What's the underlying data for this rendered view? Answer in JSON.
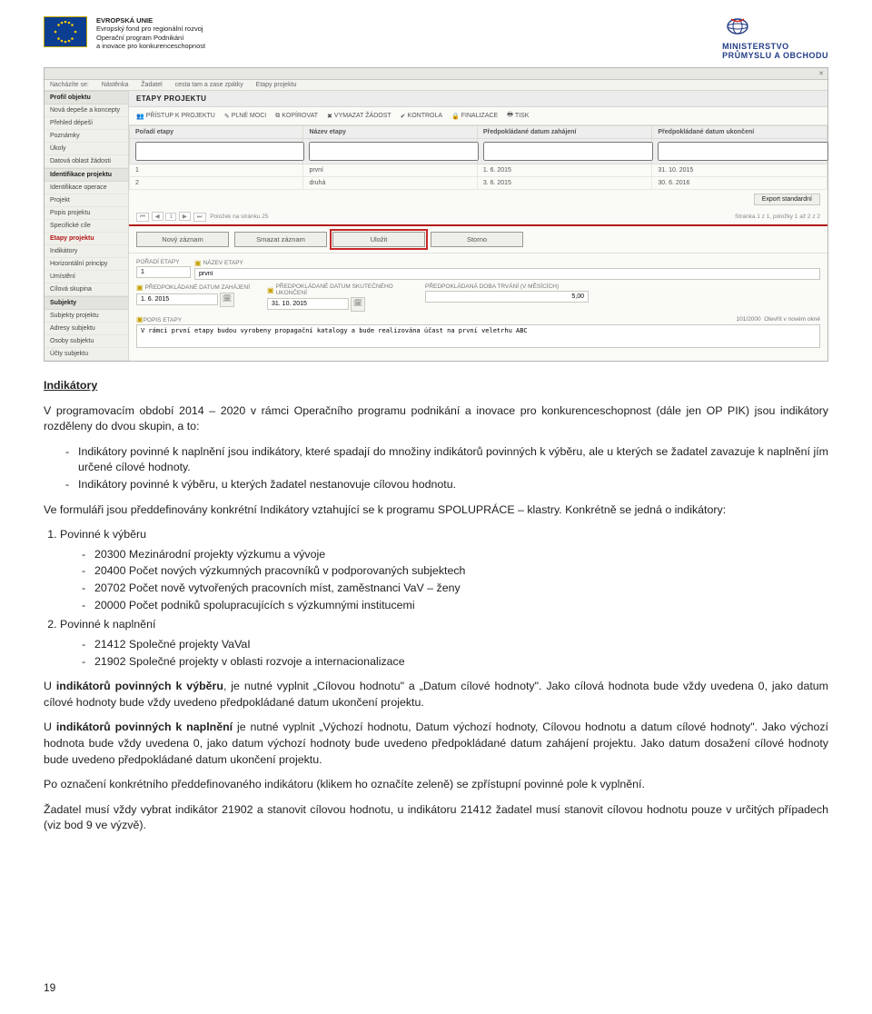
{
  "header": {
    "eu_line1": "EVROPSKÁ UNIE",
    "eu_line2": "Evropský fond pro regionální rozvoj",
    "eu_line3": "Operační program Podnikání",
    "eu_line4": "a inovace pro konkurenceschopnost",
    "mpo_line1": "MINISTERSTVO",
    "mpo_line2": "PRŮMYSLU A OBCHODU"
  },
  "breadcrumb": {
    "i1": "Nacházíte se:",
    "i2": "Nástěnka",
    "i3": "Žadatel",
    "i4": "cesta tam a zase zpátky",
    "i5": "Etapy projektu"
  },
  "sidebar": {
    "section1": "Profil objektu",
    "items1_0": "Nová depeše a koncepty",
    "items1_1": "Přehled dépeší",
    "items1_2": "Poznámky",
    "items1_3": "Úkoly",
    "items1_4": "Datová oblast žádosti",
    "section2": "Identifikace projektu",
    "items2_0": "Identifikace operace",
    "items2_1": "Projekt",
    "items2_2": "Popis projektu",
    "items2_3": "Specifické cíle",
    "items2_4": "Etapy projektu",
    "items2_5": "Indikátory",
    "items2_6": "Horizontální principy",
    "items2_7": "Umístění",
    "items2_8": "Cílová skupina",
    "section3": "Subjekty",
    "items3_0": "Subjekty projektu",
    "items3_1": "Adresy subjektu",
    "items3_2": "Osoby subjektu",
    "items3_3": "Účty subjektu"
  },
  "main": {
    "title": "ETAPY PROJEKTU",
    "toolbar_0": "PŘÍSTUP K PROJEKTU",
    "toolbar_1": "PLNÉ MOCI",
    "toolbar_2": "KOPÍROVAT",
    "toolbar_3": "VYMAZAT ŽÁDOST",
    "toolbar_4": "KONTROLA",
    "toolbar_5": "FINALIZACE",
    "toolbar_6": "TISK",
    "th_0": "Pořadí etapy",
    "th_1": "Název etapy",
    "th_2": "Předpokládané datum zahájení",
    "th_3": "Předpokládané datum ukončení",
    "rows": [
      {
        "c0": "1",
        "c1": "první",
        "c2": "1. 6. 2015",
        "c3": "31. 10. 2015"
      },
      {
        "c0": "2",
        "c1": "druhá",
        "c2": "3. 6. 2015",
        "c3": "30. 6. 2016"
      }
    ],
    "export_btn": "Export standardní",
    "pager_left_items": "Položek na stránku 25",
    "pager_right": "Stránka 1 z 1, položky 1 až 2 z 2",
    "action_new": "Nový záznam",
    "action_del": "Smazat záznam",
    "action_save": "Uložit",
    "action_storno": "Storno",
    "form": {
      "lbl_poradi": "POŘADÍ ETAPY",
      "val_poradi": "1",
      "lbl_nazev": "NÁZEV ETAPY",
      "val_nazev": "první",
      "lbl_zahajeni": "PŘEDPOKLÁDANÉ DATUM ZAHÁJENÍ",
      "val_zahajeni": "1. 6. 2015",
      "lbl_ukonceni": "PŘEDPOKLÁDANÉ DATUM SKUTEČNÉHO UKONČENÍ",
      "val_ukonceni": "31. 10. 2015",
      "lbl_doba": "PŘEDPOKLÁDANÁ DOBA TRVÁNÍ (V MĚSÍCÍCH)",
      "val_doba": "5,00",
      "lbl_popis": "POPIS ETAPY",
      "val_popis": "V rámci první etapy budou vyrobeny propagační katalogy a bude realizována účast na první veletrhu ABC",
      "counter": "101/2000",
      "counter_note": "Otevřít v novém okně"
    }
  },
  "doc": {
    "h": "Indikátory",
    "p1": "V programovacím období 2014 – 2020 v rámci Operačního programu podnikání a inovace pro konkurenceschopnost (dále jen OP PIK) jsou indikátory rozděleny do dvou skupin, a to:",
    "li1": "Indikátory povinné k naplnění jsou indikátory, které spadají do množiny indikátorů povinných k výběru, ale u kterých se žadatel zavazuje k naplnění jím určené cílové hodnoty.",
    "li2": "Indikátory povinné k výběru, u kterých žadatel nestanovuje cílovou hodnotu.",
    "p2": "Ve formuláři jsou předdefinovány konkrétní Indikátory vztahující se k programu SPOLUPRÁCE – klastry. Konkrétně se jedná o indikátory:",
    "ol1": "Povinné k výběru",
    "ol1_d0": "20300 Mezinárodní projekty výzkumu a vývoje",
    "ol1_d1": "20400 Počet nových výzkumných pracovníků v podporovaných subjektech",
    "ol1_d2": "20702 Počet nově vytvořených pracovních míst, zaměstnanci VaV – ženy",
    "ol1_d3": "20000 Počet podniků spolupracujících s výzkumnými institucemi",
    "ol2": "Povinné k naplnění",
    "ol2_d0": "21412 Společné projekty VaVaI",
    "ol2_d1": "21902 Společné projekty v oblasti rozvoje a internacionalizace",
    "p3a": "U ",
    "p3b": "indikátorů povinných k výběru",
    "p3c": ", je nutné vyplnit „Cílovou hodnotu\" a „Datum cílové hodnoty\". Jako cílová hodnota bude vždy uvedena 0, jako datum cílové hodnoty bude vždy uvedeno předpokládané datum ukončení projektu.",
    "p4a": "U ",
    "p4b": "indikátorů povinných k naplnění",
    "p4c": " je nutné vyplnit „Výchozí hodnotu, Datum výchozí hodnoty, Cílovou hodnotu a datum cílové hodnoty\". Jako výchozí hodnota bude vždy uvedena 0, jako datum výchozí hodnoty bude uvedeno předpokládané datum zahájení projektu. Jako datum dosažení cílové hodnoty bude uvedeno předpokládané datum ukončení projektu.",
    "p5": "Po označení konkrétního předdefinovaného indikátoru (klikem ho označíte zeleně) se zpřístupní povinné pole k vyplnění.",
    "p6": "Žadatel musí vždy vybrat indikátor 21902 a stanovit cílovou hodnotu, u indikátoru 21412 žadatel musí stanovit cílovou hodnotu pouze v určitých případech (viz bod 9 ve výzvě).",
    "pagenum": "19"
  }
}
